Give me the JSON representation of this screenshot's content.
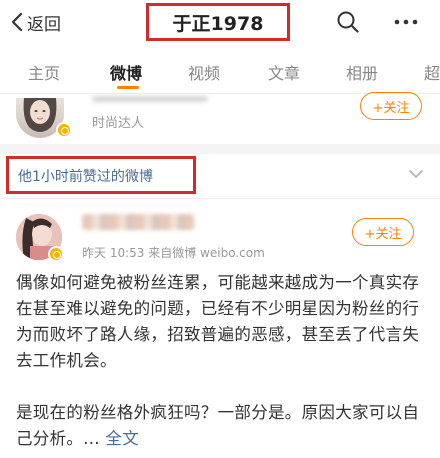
{
  "topbar": {
    "back_label": "返回",
    "title": "于正1978"
  },
  "tabs": [
    {
      "label": "主页"
    },
    {
      "label": "微博"
    },
    {
      "label": "视频"
    },
    {
      "label": "文章"
    },
    {
      "label": "相册"
    },
    {
      "label": "超"
    }
  ],
  "active_tab": "微博",
  "recommended_user": {
    "description": "时尚达人",
    "follow_label": "+关注"
  },
  "section": {
    "title": "他1小时前赞过的微博"
  },
  "post": {
    "time": "昨天 10:53",
    "source": "来自微博 weibo.com",
    "follow_label": "+关注",
    "paragraph1": "偶像如何避免被粉丝连累，可能越来越成为一个真实存在甚至难以避免的问题，已经有不少明星因为粉丝的行为而败坏了路人缘，招致普遍的恶感，甚至丢了代言失去工作机会。",
    "paragraph2": "是现在的粉丝格外疯狂吗？一部分是。原因大家可以自己分析。...",
    "full_text_label": "全文"
  },
  "colors": {
    "accent": "#ff8200",
    "link": "#4d6b93",
    "highlight_box": "#d12b2b"
  },
  "icons": [
    "chevron-left-icon",
    "search-icon",
    "more-icon",
    "chevron-down-icon",
    "verified-badge-icon"
  ]
}
